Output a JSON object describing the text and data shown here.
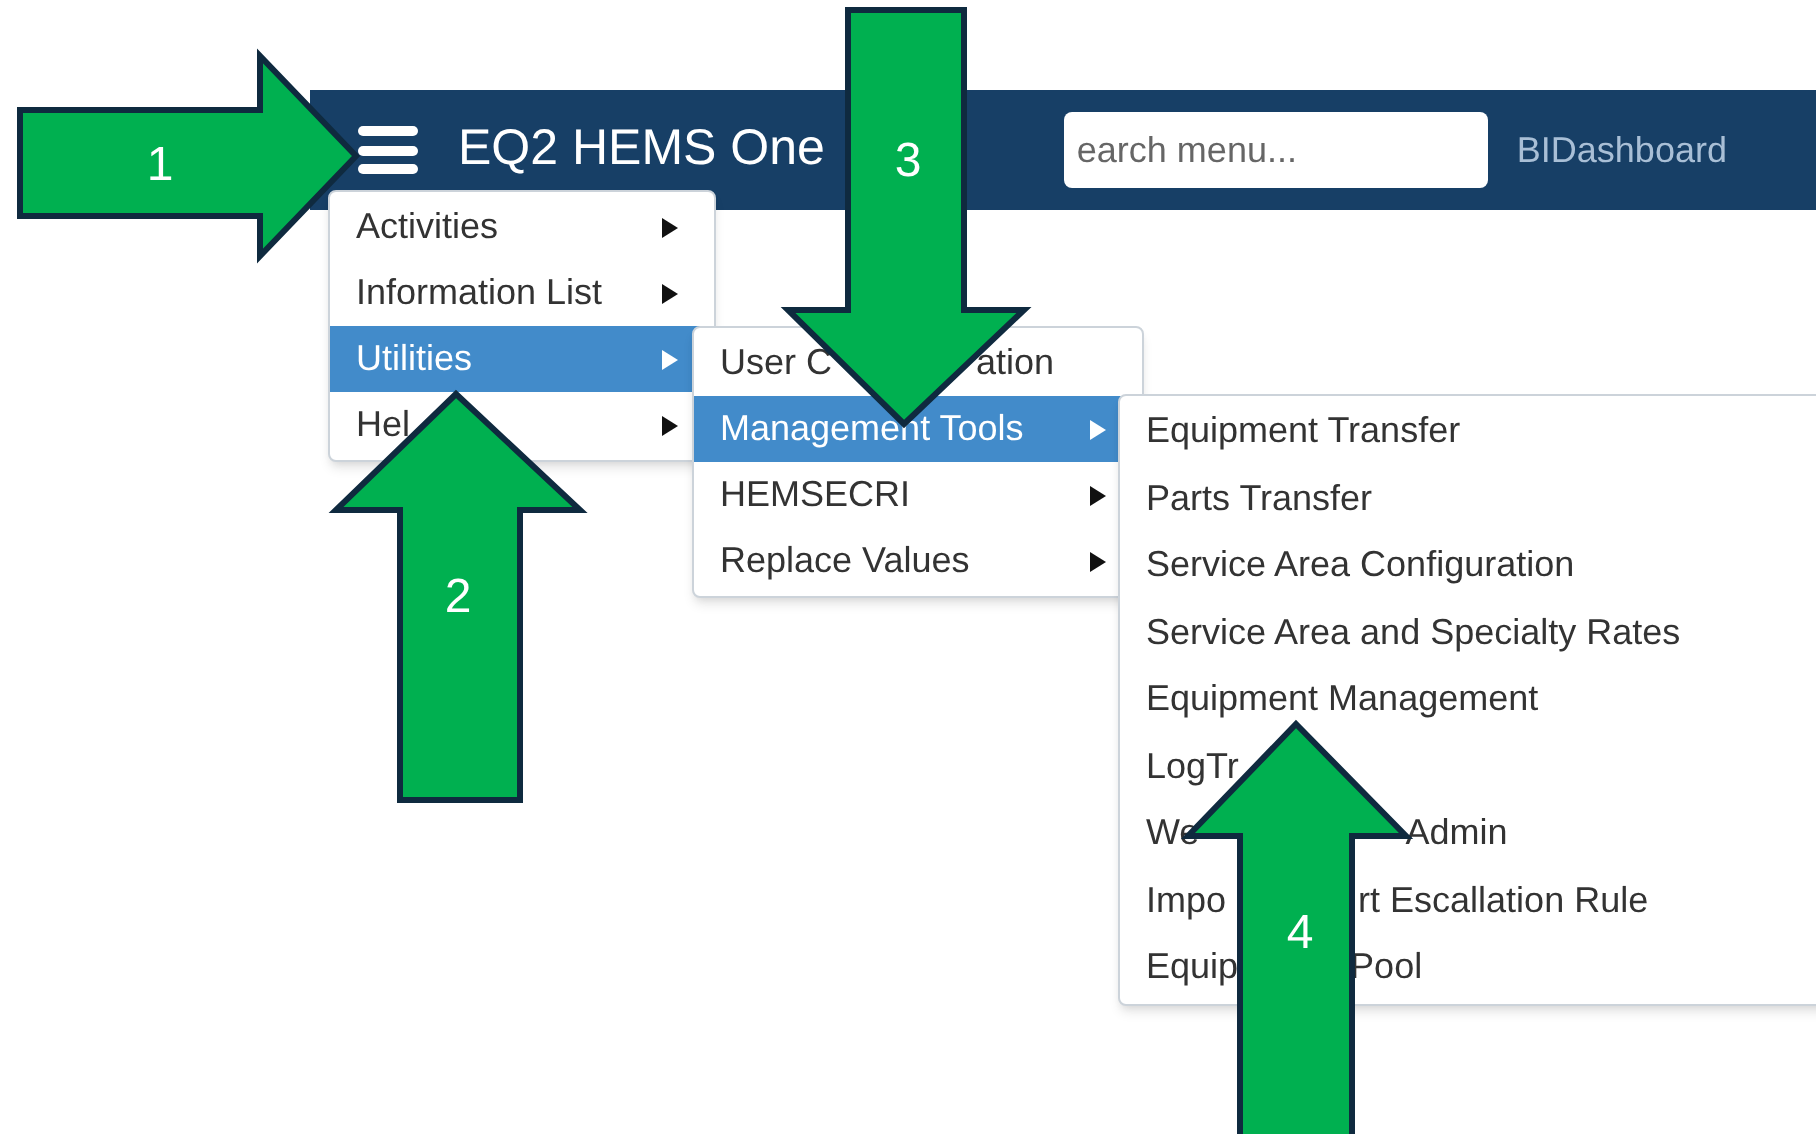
{
  "header": {
    "title": "EQ2 HEMS One",
    "search": {
      "placeholder": "earch menu..."
    },
    "link": "BIDashboard"
  },
  "menus": [
    {
      "items": [
        {
          "label": "Activities",
          "selected": false
        },
        {
          "label": "Information List",
          "selected": false
        },
        {
          "label": "Utilities",
          "selected": true
        },
        {
          "label": "Hel",
          "selected": false
        }
      ]
    },
    {
      "items": [
        {
          "label": "User C",
          "label_end": "ation",
          "selected": false,
          "submenu": false
        },
        {
          "label": "Management Tools",
          "selected": true,
          "submenu": true
        },
        {
          "label": "HEMSECRI",
          "selected": false,
          "submenu": true
        },
        {
          "label": "Replace Values",
          "selected": false,
          "submenu": true
        }
      ]
    },
    {
      "items": [
        {
          "label": "Equipment Transfer",
          "selected": false
        },
        {
          "label": "Parts Transfer",
          "selected": false
        },
        {
          "label": "Service Area Configuration",
          "selected": false
        },
        {
          "label": "Service Area and Specialty Rates",
          "selected": false
        },
        {
          "label": "Equipment Management",
          "selected": false
        },
        {
          "label": "LogTr",
          "selected": false
        },
        {
          "label": "We",
          "label_end": "Admin",
          "selected": false
        },
        {
          "label": "Impo",
          "label_end": "rt Escallation Rule",
          "selected": false
        },
        {
          "label": "Equip",
          "label_end": "Pool",
          "selected": false
        }
      ]
    }
  ],
  "callouts": [
    {
      "number": "1"
    },
    {
      "number": "2"
    },
    {
      "number": "3"
    },
    {
      "number": "4"
    }
  ]
}
